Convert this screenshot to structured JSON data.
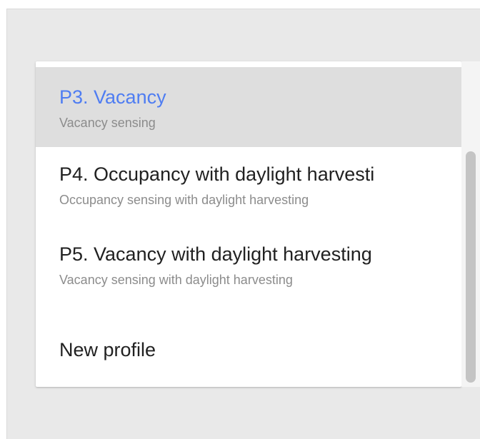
{
  "dropdown": {
    "options": [
      {
        "title": "P3. Vacancy",
        "subtitle": "Vacancy sensing",
        "selected": true
      },
      {
        "title": "P4. Occupancy with daylight harvesti",
        "subtitle": "Occupancy sensing with daylight harvesting",
        "selected": false
      },
      {
        "title": "P5. Vacancy with daylight harvesting",
        "subtitle": "Vacancy sensing with daylight harvesting",
        "selected": false
      },
      {
        "title": "New profile",
        "subtitle": "",
        "selected": false
      }
    ]
  },
  "colors": {
    "selected_text": "#4f7df2",
    "selected_background": "#dedede",
    "text": "#212121",
    "subtext": "#8c8c8c"
  }
}
